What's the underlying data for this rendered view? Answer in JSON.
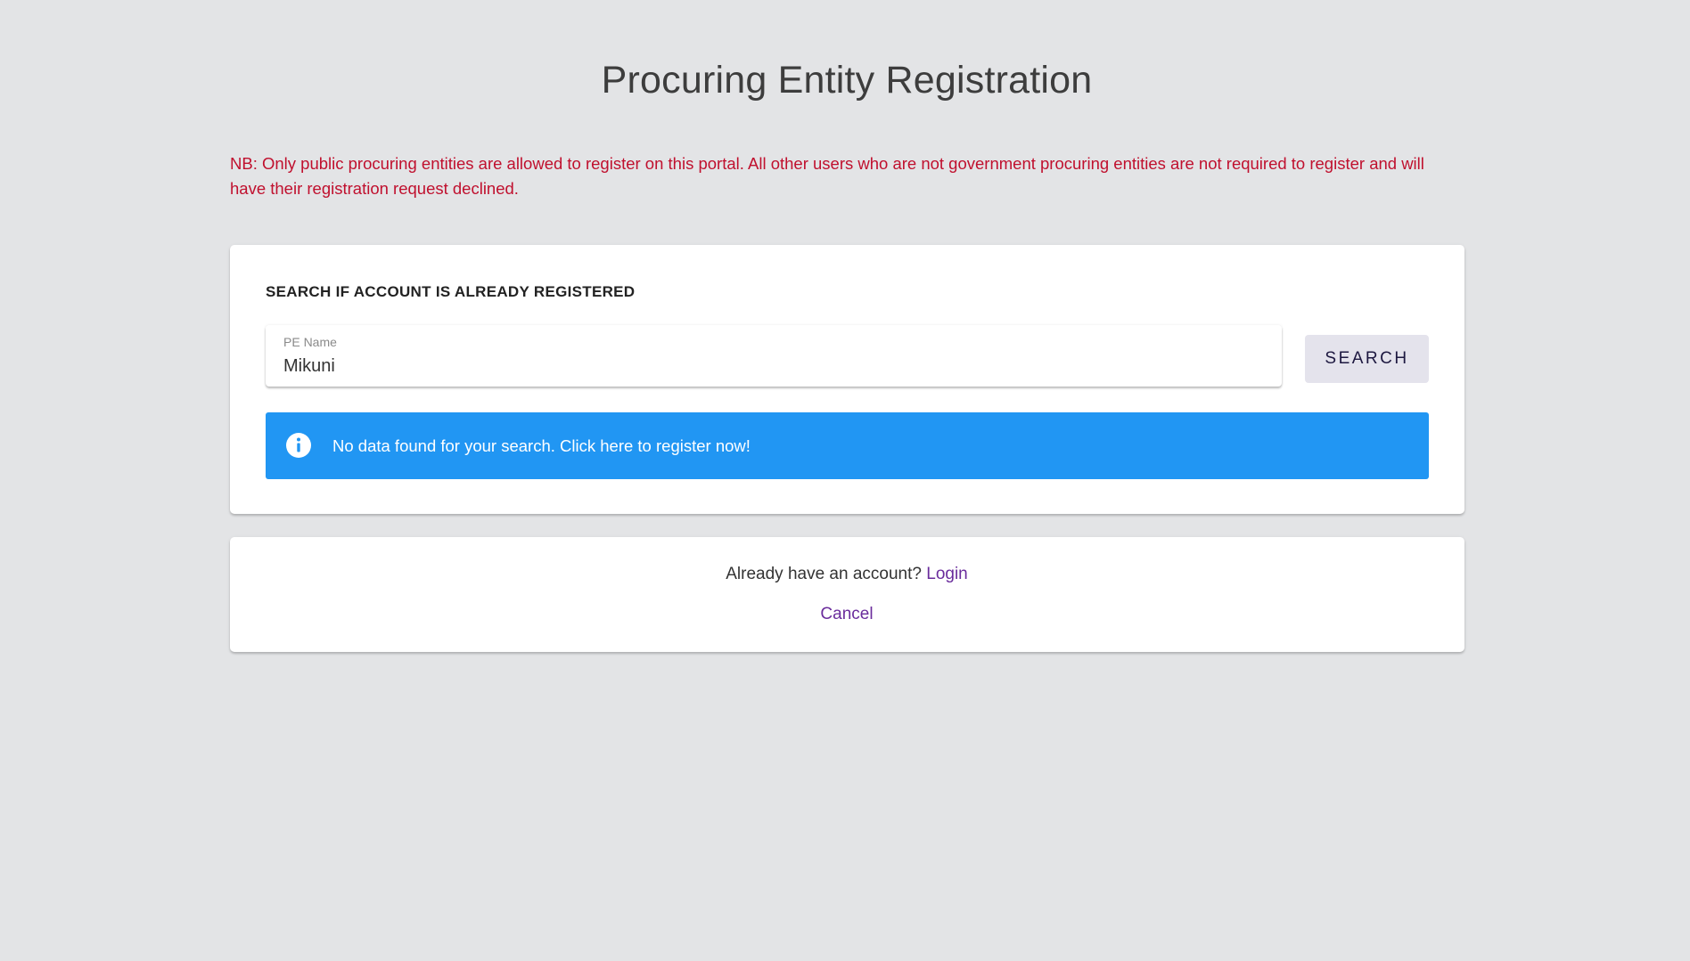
{
  "page": {
    "title": "Procuring Entity Registration",
    "notice": "NB: Only public procuring entities are allowed to register on this portal. All other users who are not government procuring entities are not required to register and will have their registration request declined."
  },
  "search": {
    "heading": "SEARCH IF ACCOUNT IS ALREADY REGISTERED",
    "field_label": "PE Name",
    "field_value": "Mikuni",
    "button_label": "SEARCH",
    "result_message": "No data found for your search. Click here to register now!",
    "result_icon": "info-icon"
  },
  "account": {
    "prompt": "Already have an account?",
    "login_label": "Login",
    "cancel_label": "Cancel"
  },
  "colors": {
    "background": "#e3e4e6",
    "notice": "#c0102e",
    "alert": "#2196f3",
    "link": "#6a2c9c"
  }
}
